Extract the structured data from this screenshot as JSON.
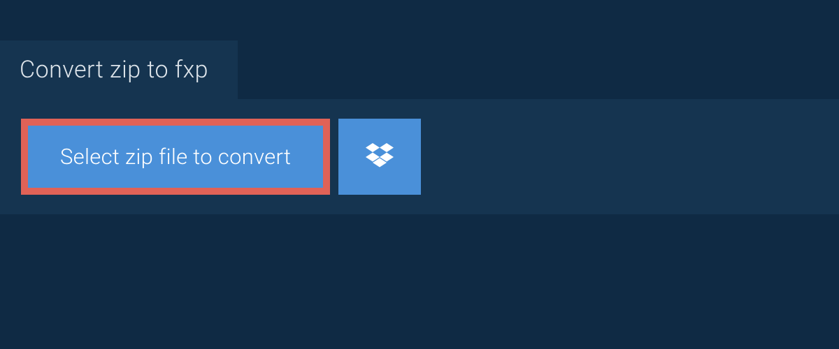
{
  "header": {
    "title": "Convert zip to fxp"
  },
  "actions": {
    "select_file_label": "Select zip file to convert",
    "dropbox_icon": "dropbox-icon"
  },
  "colors": {
    "background": "#0f2a44",
    "panel": "#153450",
    "button": "#4a90d9",
    "highlight_border": "#e06257",
    "text_light": "#dde4ea",
    "text_white": "#ffffff"
  }
}
